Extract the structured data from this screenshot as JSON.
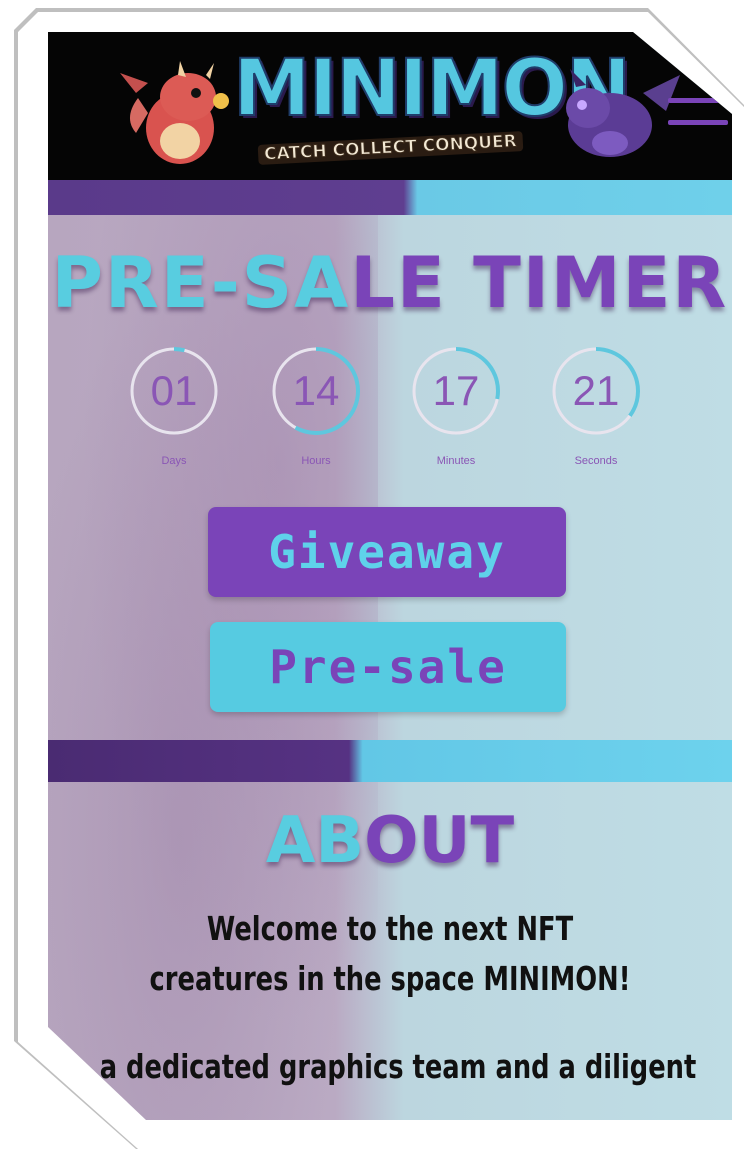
{
  "header": {
    "logo_title": "MINIMON",
    "logo_tagline": "CATCH COLLECT CONQUER",
    "menu_icon": "hamburger-menu-icon"
  },
  "timer": {
    "title_part1": "PRE-SA",
    "title_part2": "LE TIMER",
    "units": [
      {
        "value": "01",
        "label": "Days",
        "progress": 0.04
      },
      {
        "value": "14",
        "label": "Hours",
        "progress": 0.58
      },
      {
        "value": "17",
        "label": "Minutes",
        "progress": 0.28
      },
      {
        "value": "21",
        "label": "Seconds",
        "progress": 0.35
      }
    ]
  },
  "buttons": {
    "giveaway": "Giveaway",
    "presale": "Pre-sale"
  },
  "about": {
    "title_part1": "AB",
    "title_part2": "OUT",
    "paragraph1": "Welcome to the next NFT creatures in the space MINIMON!",
    "paragraph2": "a dedicated graphics team and a diligent"
  },
  "colors": {
    "purple": "#7a44b8",
    "cyan": "#58cde0",
    "header_bg": "#050505"
  }
}
